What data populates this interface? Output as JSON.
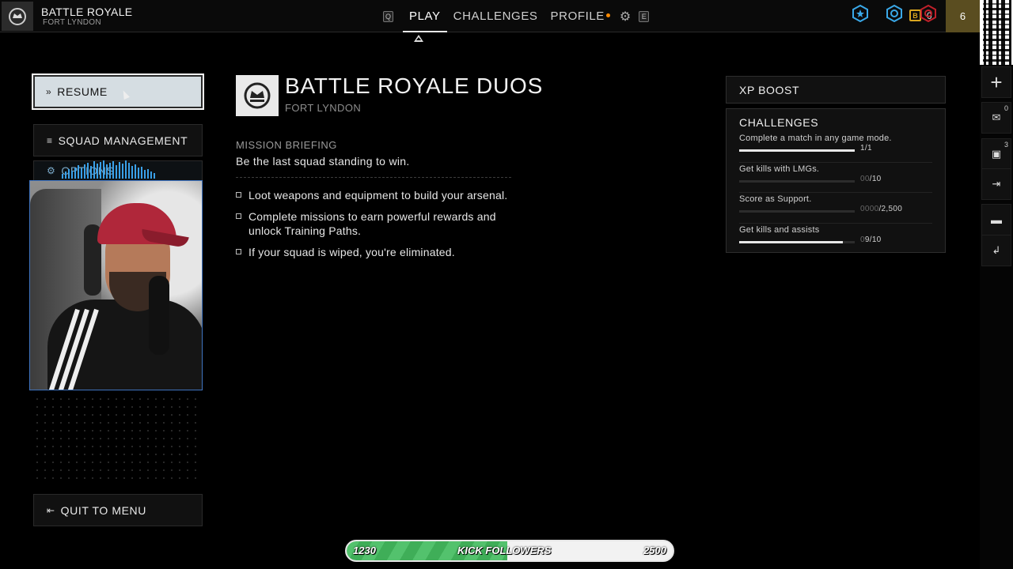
{
  "header": {
    "mode_title": "BATTLE ROYALE",
    "mode_subtitle": "FORT LYNDON",
    "key_left": "Q",
    "key_right": "E",
    "tabs": [
      {
        "label": "PLAY",
        "active": true
      },
      {
        "label": "CHALLENGES",
        "active": false
      },
      {
        "label": "PROFILE",
        "active": false
      }
    ],
    "currency_symbol": "B",
    "currency_amount": "0",
    "player_level": "6"
  },
  "menu": {
    "resume": "RESUME",
    "squad": "SQUAD MANAGEMENT",
    "options": "OPTIONS",
    "quit": "QUIT TO MENU"
  },
  "mission": {
    "title": "BATTLE ROYALE DUOS",
    "subtitle": "FORT LYNDON",
    "briefing_heading": "MISSION BRIEFING",
    "briefing_text": "Be the last squad standing to win.",
    "bullets": [
      "Loot weapons and equipment to build your arsenal.",
      "Complete missions to earn powerful rewards and unlock Training Paths.",
      "If your squad is wiped, you're eliminated."
    ]
  },
  "xp_boost": {
    "label": "XP BOOST",
    "icons": [
      "star-badge-icon",
      "gear-badge-icon",
      "red-badge-icon"
    ],
    "colors": [
      "#3aa8e8",
      "#3aa8e8",
      "#c0202a"
    ]
  },
  "challenges": {
    "heading": "CHALLENGES",
    "items": [
      {
        "name": "Complete a match in any game mode.",
        "dim": "",
        "progress": "1/1",
        "fraction": 1.0
      },
      {
        "name": "Get kills with LMGs.",
        "dim": "00",
        "progress": "/10",
        "fraction": 0.0
      },
      {
        "name": "Score as Support.",
        "dim": "0000",
        "progress": "/2,500",
        "fraction": 0.0
      },
      {
        "name": "Get kills and assists",
        "dim": "0",
        "progress": "9/10",
        "fraction": 0.9
      }
    ]
  },
  "sidebar": {
    "counts": [
      "0",
      "3"
    ],
    "icons": [
      "plus-icon",
      "mail-icon",
      "gift-icon",
      "ticket-icon",
      "chat-icon",
      "exit-icon"
    ]
  },
  "followers": {
    "current": "1230",
    "label": "KICK FOLLOWERS",
    "goal": "2500",
    "fraction": 0.492
  }
}
